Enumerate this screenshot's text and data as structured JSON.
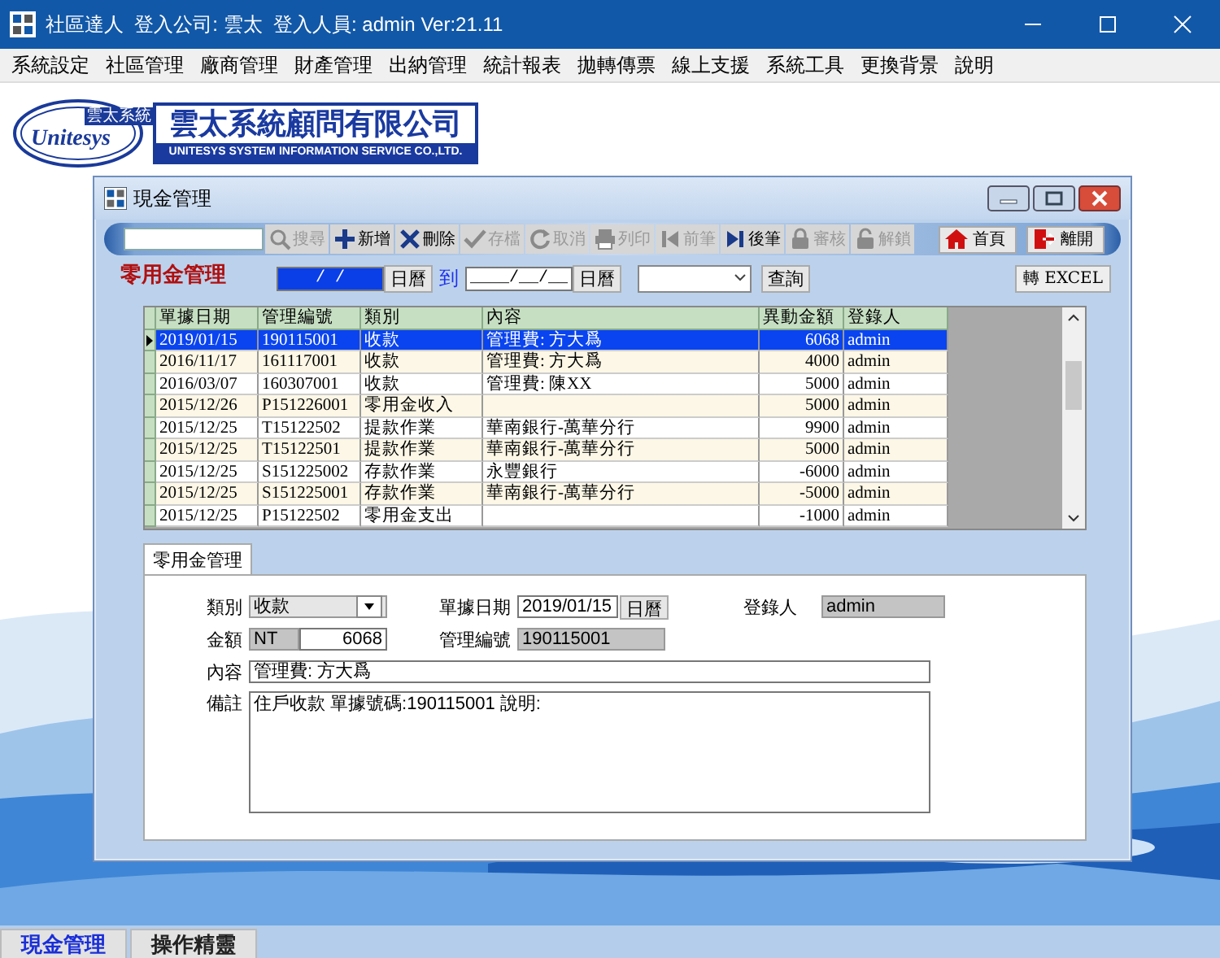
{
  "window": {
    "title": "社區達人  登入公司: 雲太  登入人員: admin Ver:21.11"
  },
  "menu": [
    "系統設定",
    "社區管理",
    "廠商管理",
    "財產管理",
    "出納管理",
    "統計報表",
    "拋轉傳票",
    "線上支援",
    "系統工具",
    "更換背景",
    "說明"
  ],
  "logo": {
    "mark_text": "Unitesys",
    "mark_badge": "雲太系統",
    "company_name": "雲太系統顧問有限公司",
    "company_english": "UNITESYS SYSTEM INFORMATION SERVICE CO.,LTD."
  },
  "child_window": {
    "title": "現金管理"
  },
  "toolbar": {
    "buttons": [
      {
        "label": "搜尋",
        "disabled": true
      },
      {
        "label": "新增",
        "disabled": false
      },
      {
        "label": "刪除",
        "disabled": false
      },
      {
        "label": "存檔",
        "disabled": true
      },
      {
        "label": "取消",
        "disabled": true
      },
      {
        "label": "列印",
        "disabled": true
      },
      {
        "label": "前筆",
        "disabled": true
      },
      {
        "label": "後筆",
        "disabled": false
      },
      {
        "label": "審核",
        "disabled": true
      },
      {
        "label": "解鎖",
        "disabled": true
      }
    ],
    "nav_buttons": [
      {
        "label": "首頁"
      },
      {
        "label": "離開"
      }
    ]
  },
  "filter": {
    "heading": "零用金管理",
    "date_from": {
      "value": "/ /",
      "selected": true
    },
    "calendar_from": "日曆",
    "to_label": "到",
    "date_to": {
      "value": "____/__/__",
      "selected": false
    },
    "calendar_to": "日曆",
    "query_button": "查詢",
    "export_button": "轉 EXCEL"
  },
  "grid": {
    "columns": [
      "單據日期",
      "管理編號",
      "類別",
      "內容",
      "異動金額",
      "登錄人"
    ],
    "rows": [
      {
        "cells": [
          "2019/01/15",
          "190115001",
          "收款",
          "管理費: 方大爲",
          "6068",
          "admin"
        ],
        "selected": true
      },
      {
        "cells": [
          "2016/11/17",
          "161117001",
          "收款",
          "管理費: 方大爲",
          "4000",
          "admin"
        ],
        "selected": false
      },
      {
        "cells": [
          "2016/03/07",
          "160307001",
          "收款",
          "管理費: 陳XX",
          "5000",
          "admin"
        ],
        "selected": false
      },
      {
        "cells": [
          "2015/12/26",
          "P151226001",
          "零用金收入",
          "",
          "5000",
          "admin"
        ],
        "selected": false
      },
      {
        "cells": [
          "2015/12/25",
          "T15122502",
          "提款作業",
          "華南銀行-萬華分行",
          "9900",
          "admin"
        ],
        "selected": false
      },
      {
        "cells": [
          "2015/12/25",
          "T15122501",
          "提款作業",
          "華南銀行-萬華分行",
          "5000",
          "admin"
        ],
        "selected": false
      },
      {
        "cells": [
          "2015/12/25",
          "S151225002",
          "存款作業",
          "永豐銀行",
          "-6000",
          "admin"
        ],
        "selected": false
      },
      {
        "cells": [
          "2015/12/25",
          "S151225001",
          "存款作業",
          "華南銀行-萬華分行",
          "-5000",
          "admin"
        ],
        "selected": false
      },
      {
        "cells": [
          "2015/12/25",
          "P15122502",
          "零用金支出",
          "",
          "-1000",
          "admin"
        ],
        "selected": false
      }
    ]
  },
  "detail": {
    "tab": "零用金管理",
    "category": {
      "label": "類別",
      "value": "收款"
    },
    "voucher_date": {
      "label": "單據日期",
      "value": "2019/01/15",
      "button": "日曆"
    },
    "recorder": {
      "label": "登錄人",
      "value": "admin"
    },
    "amount": {
      "label": "金額",
      "currency": "NT",
      "value": "6068"
    },
    "manage_no": {
      "label": "管理編號",
      "value": "190115001"
    },
    "content": {
      "label": "內容",
      "value": "管理費: 方大爲"
    },
    "remarks": {
      "label": "備註",
      "value": "住戶收款 單據號碼:190115001 說明:"
    }
  },
  "bottom_tabs": [
    {
      "label": "現金管理",
      "selected": true
    },
    {
      "label": "操作精靈",
      "selected": false
    }
  ]
}
